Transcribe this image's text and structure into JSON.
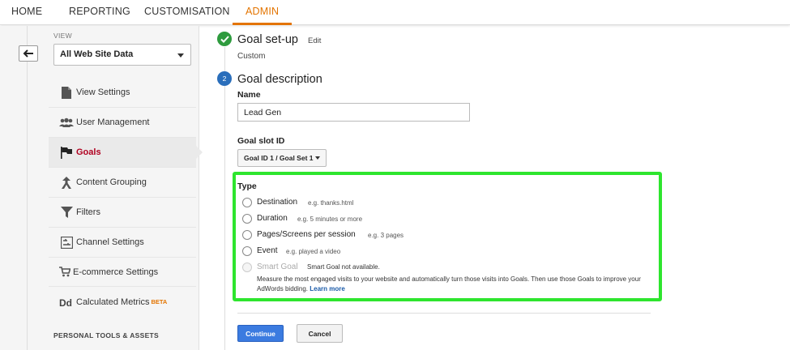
{
  "nav": {
    "items": [
      {
        "label": "HOME"
      },
      {
        "label": "REPORTING"
      },
      {
        "label": "CUSTOMISATION"
      },
      {
        "label": "ADMIN"
      }
    ],
    "active": "ADMIN",
    "accent_color": "#e37400"
  },
  "sidebar": {
    "view_label": "VIEW",
    "view_selected": "All Web Site Data",
    "items": [
      {
        "label": "View Settings",
        "icon": "document-icon"
      },
      {
        "label": "User Management",
        "icon": "users-icon"
      },
      {
        "label": "Goals",
        "icon": "flag-icon",
        "active": true
      },
      {
        "label": "Content Grouping",
        "icon": "grouping-icon"
      },
      {
        "label": "Filters",
        "icon": "filter-icon"
      },
      {
        "label": "Channel Settings",
        "icon": "channel-settings-icon"
      },
      {
        "label": "E-commerce Settings",
        "icon": "cart-icon"
      },
      {
        "label": "Calculated Metrics",
        "icon": "dd-icon",
        "badge": "BETA"
      }
    ],
    "personal_heading": "PERSONAL TOOLS & ASSETS"
  },
  "goal_setup": {
    "title": "Goal set-up",
    "edit_label": "Edit",
    "value": "Custom"
  },
  "goal_description": {
    "step_number": "2",
    "title": "Goal description",
    "name_label": "Name",
    "name_value": "Lead Gen",
    "slot_label": "Goal slot ID",
    "slot_value": "Goal ID 1 / Goal Set 1"
  },
  "type": {
    "label": "Type",
    "highlight_color": "#2ee52e",
    "options": [
      {
        "label": "Destination",
        "hint": "e.g. thanks.html"
      },
      {
        "label": "Duration",
        "hint": "e.g. 5 minutes or more"
      },
      {
        "label": "Pages/Screens per session",
        "hint": "e.g. 3 pages"
      },
      {
        "label": "Event",
        "hint": "e.g. played a video"
      },
      {
        "label": "Smart Goal",
        "hint": "Smart Goal not available.",
        "disabled": true
      }
    ],
    "smart_description": "Measure the most engaged visits to your website and automatically turn those visits into Goals. Then use those Goals to improve your AdWords bidding.",
    "learn_more": "Learn more"
  },
  "actions": {
    "continue_label": "Continue",
    "cancel_label": "Cancel",
    "continue_color": "#3b7be0"
  }
}
